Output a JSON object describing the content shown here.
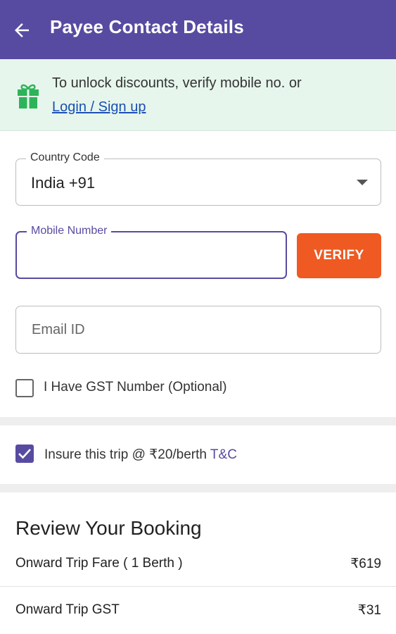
{
  "header": {
    "title": "Payee Contact Details",
    "back_icon": "arrow-left-icon",
    "background": "#574ba1"
  },
  "banner": {
    "text": "To unlock discounts, verify mobile no. or",
    "link": "Login / Sign up",
    "icon": "gift-icon",
    "background": "#e6f6ec"
  },
  "form": {
    "country_code": {
      "label": "Country Code",
      "value": "India +91"
    },
    "mobile": {
      "label": "Mobile Number",
      "value": ""
    },
    "verify_label": "VERIFY",
    "email": {
      "placeholder": "Email ID",
      "value": ""
    },
    "gst": {
      "label": "I Have GST Number (Optional)",
      "checked": false
    }
  },
  "insurance": {
    "label": "Insure this trip @ ₹20/berth",
    "link": "T&C",
    "checked": true
  },
  "review": {
    "title": "Review Your Booking",
    "rows": [
      {
        "label": "Onward Trip Fare ( 1 Berth )",
        "value": "₹619"
      },
      {
        "label": "Onward Trip GST",
        "value": "₹31"
      }
    ]
  },
  "colors": {
    "primary": "#574ba1",
    "accent": "#ee5a22",
    "link": "#1a4fb5",
    "gift": "#2eb35a"
  }
}
